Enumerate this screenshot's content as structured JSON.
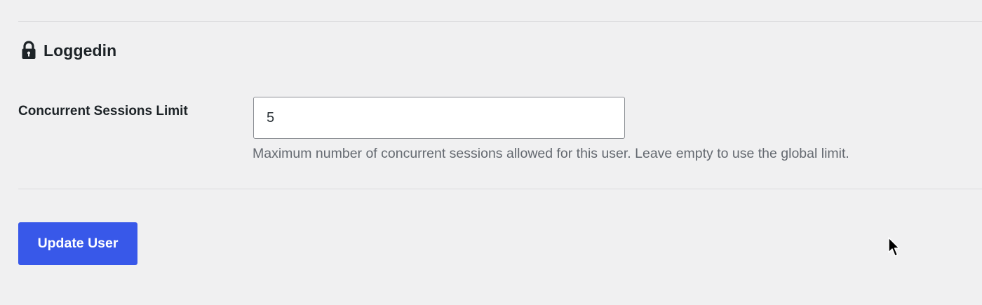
{
  "section": {
    "title": "Loggedin",
    "icon": "lock-icon"
  },
  "form": {
    "sessions_limit": {
      "label": "Concurrent Sessions Limit",
      "value": "5",
      "description": "Maximum number of concurrent sessions allowed for this user. Leave empty to use the global limit."
    }
  },
  "actions": {
    "update_label": "Update User"
  },
  "colors": {
    "background": "#f0f0f1",
    "primary_button": "#3858e9",
    "description_text": "#646970"
  }
}
